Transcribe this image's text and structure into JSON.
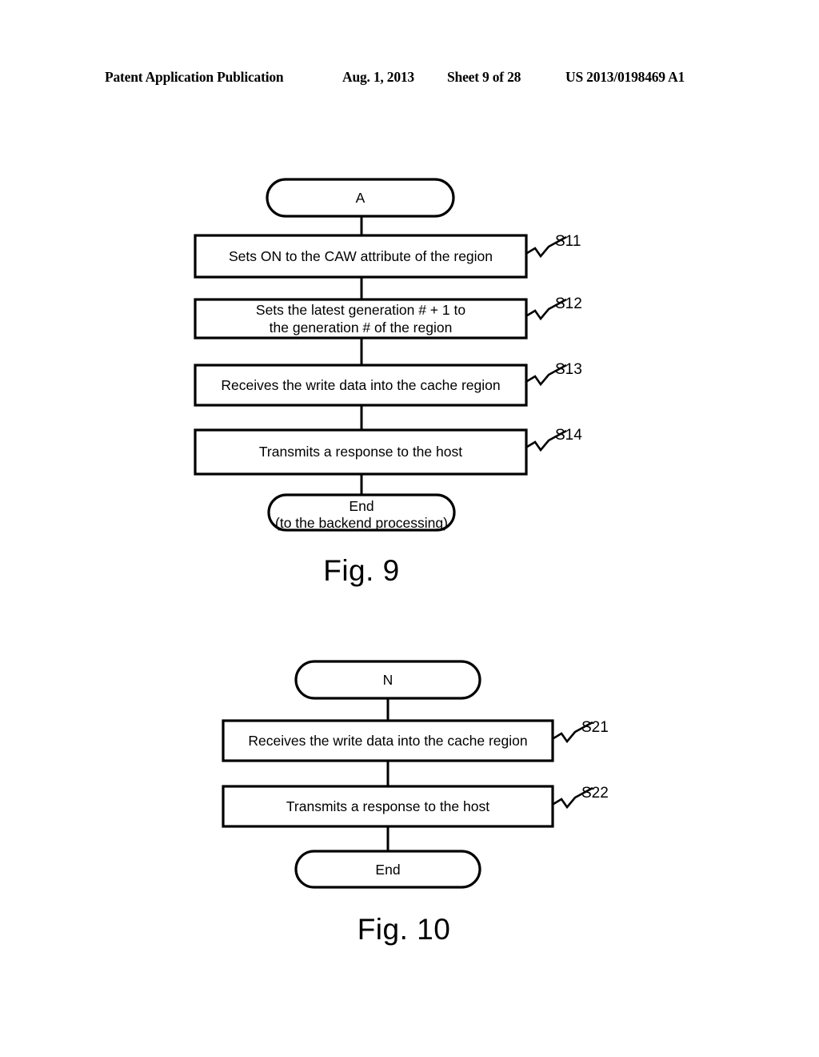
{
  "header": {
    "publication": "Patent Application Publication",
    "date": "Aug. 1, 2013",
    "sheet": "Sheet 9 of 28",
    "patent_number": "US 2013/0198469 A1"
  },
  "figures": [
    {
      "caption": "Fig. 9",
      "start_terminal": "A",
      "nodes": [
        {
          "id": "S11",
          "text": "Sets ON to the CAW attribute of the region",
          "label": "S11"
        },
        {
          "id": "S12",
          "text": "Sets the latest generation # + 1 to\nthe generation # of the region",
          "label": "S12"
        },
        {
          "id": "S13",
          "text": "Receives the write data into the cache region",
          "label": "S13"
        },
        {
          "id": "S14",
          "text": "Transmits a response to the host",
          "label": "S14"
        }
      ],
      "end_terminal": "End\n(to the backend processing)"
    },
    {
      "caption": "Fig. 10",
      "start_terminal": "N",
      "nodes": [
        {
          "id": "S21",
          "text": "Receives the write data into the cache region",
          "label": "S21"
        },
        {
          "id": "S22",
          "text": "Transmits a response to the host",
          "label": "S22"
        }
      ],
      "end_terminal": "End"
    }
  ],
  "style": {
    "line_color": "#000000",
    "fill_color": "#ffffff"
  }
}
